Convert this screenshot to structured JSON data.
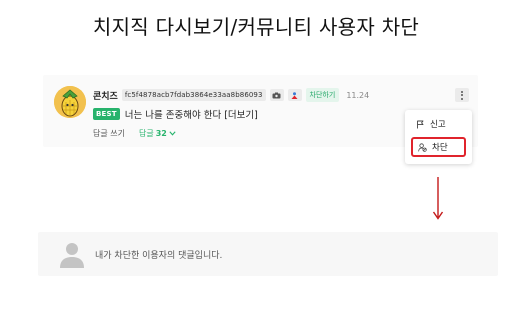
{
  "page": {
    "title": "치지직 다시보기/커뮤니티 사용자 차단"
  },
  "comment": {
    "nickname": "콘치즈",
    "user_hash": "fc5f4878acb7fdab3864e33aa8b86093",
    "block_tag": "차단하기",
    "timestamp": "11.24",
    "best_label": "BEST",
    "text": "너는 나를 존중해야 한다 [더보기]",
    "reply_write": "답글 쓰기",
    "reply_label": "답글",
    "reply_count": "32"
  },
  "menu": {
    "items": [
      {
        "label": "신고",
        "icon": "flag-icon"
      },
      {
        "label": "차단",
        "icon": "user-block-icon"
      }
    ]
  },
  "blocked_comment": {
    "text": "내가 차단한 이용자의 댓글입니다."
  },
  "colors": {
    "accent_green": "#27b36c",
    "highlight_red": "#e0242c",
    "card_bg": "#fafafa"
  }
}
